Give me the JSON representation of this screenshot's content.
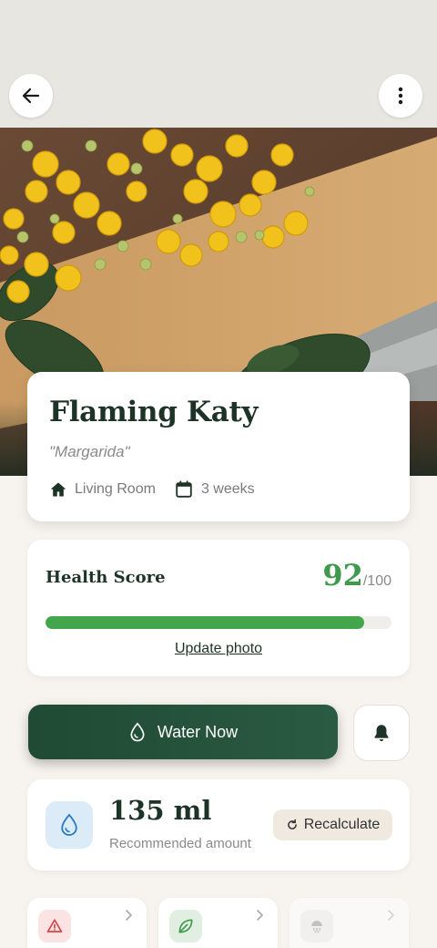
{
  "header": {
    "back_icon": "arrow-left-icon",
    "more_icon": "more-vertical-icon"
  },
  "hero": {
    "alt": "Flaming Katy plant photo"
  },
  "plant": {
    "name": "Flaming Katy",
    "nickname": "\"Margarida\"",
    "location": "Living Room",
    "location_icon": "home-icon",
    "age": "3 weeks",
    "age_icon": "calendar-icon"
  },
  "health": {
    "title": "Health Score",
    "score": "92",
    "max": "/100",
    "progress_fraction": 0.92,
    "update_link": "Update photo",
    "bar_color": "#43a64c",
    "score_color": "#3f9a4d"
  },
  "actions": {
    "water_label": "Water Now",
    "water_icon": "water-drop-icon",
    "reminder_icon": "bell-icon"
  },
  "watering": {
    "amount": "135 ml",
    "label": "Recommended amount",
    "recalc_label": "Recalculate",
    "drop_icon": "water-drop-icon",
    "recalc_icon": "refresh-icon"
  },
  "quick_links": [
    {
      "icon": "warning-icon",
      "color": "#d64545"
    },
    {
      "icon": "leaf-icon",
      "color": "#3f9a4d"
    },
    {
      "icon": "shower-icon",
      "color": "#9a9a9a"
    }
  ],
  "colors": {
    "primary_dark": "#1f4a34",
    "background": "#f7f3ee",
    "accent_green": "#43a64c"
  }
}
